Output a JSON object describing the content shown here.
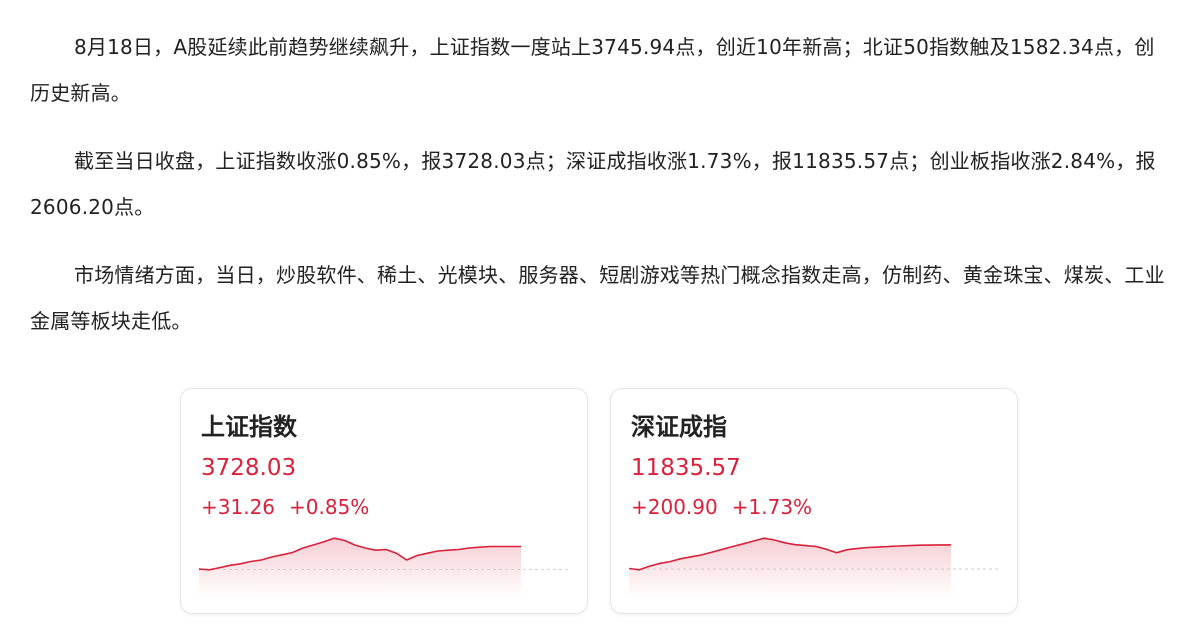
{
  "paragraphs": [
    "8月18日，A股延续此前趋势继续飙升，上证指数一度站上3745.94点，创近10年新高；北证50指数触及1582.34点，创历史新高。",
    "截至当日收盘，上证指数收涨0.85%，报3728.03点；深证成指收涨1.73%，报11835.57点；创业板指收涨2.84%，报2606.20点。",
    "市场情绪方面，当日，炒股软件、稀土、光模块、服务器、短剧游戏等热门概念指数走高，仿制药、黄金珠宝、煤炭、工业金属等板块走低。"
  ],
  "cards": [
    {
      "name": "上证指数",
      "price": "3728.03",
      "change": "+31.26",
      "change_pct": "+0.85%"
    },
    {
      "name": "深证成指",
      "price": "11835.57",
      "change": "+200.90",
      "change_pct": "+1.73%"
    }
  ],
  "colors": {
    "up": "#d9213a",
    "baseline": "#cfcfcf"
  },
  "chart_data": [
    {
      "type": "line",
      "series": [
        {
          "values": [
            3697,
            3696.5,
            3698,
            3699.5,
            3700.5,
            3702,
            3703,
            3705,
            3706.5,
            3708,
            3711,
            3713,
            3715,
            3717.5,
            3716,
            3713,
            3711,
            3709.5,
            3710,
            3707.5,
            3703,
            3706,
            3707.5,
            3709,
            3709.5,
            3710,
            3711,
            3711.5,
            3712,
            3712,
            3712,
            3712
          ]
        }
      ],
      "baseline": 3696.77
    },
    {
      "type": "line",
      "series": [
        {
          "values": [
            11637,
            11630,
            11650,
            11665,
            11675,
            11690,
            11700,
            11710,
            11725,
            11740,
            11755,
            11770,
            11785,
            11800,
            11790,
            11775,
            11765,
            11760,
            11755,
            11740,
            11722,
            11738,
            11745,
            11750,
            11752,
            11755,
            11758,
            11760,
            11762,
            11763,
            11764,
            11764
          ]
        }
      ],
      "baseline": 11634.67
    }
  ]
}
